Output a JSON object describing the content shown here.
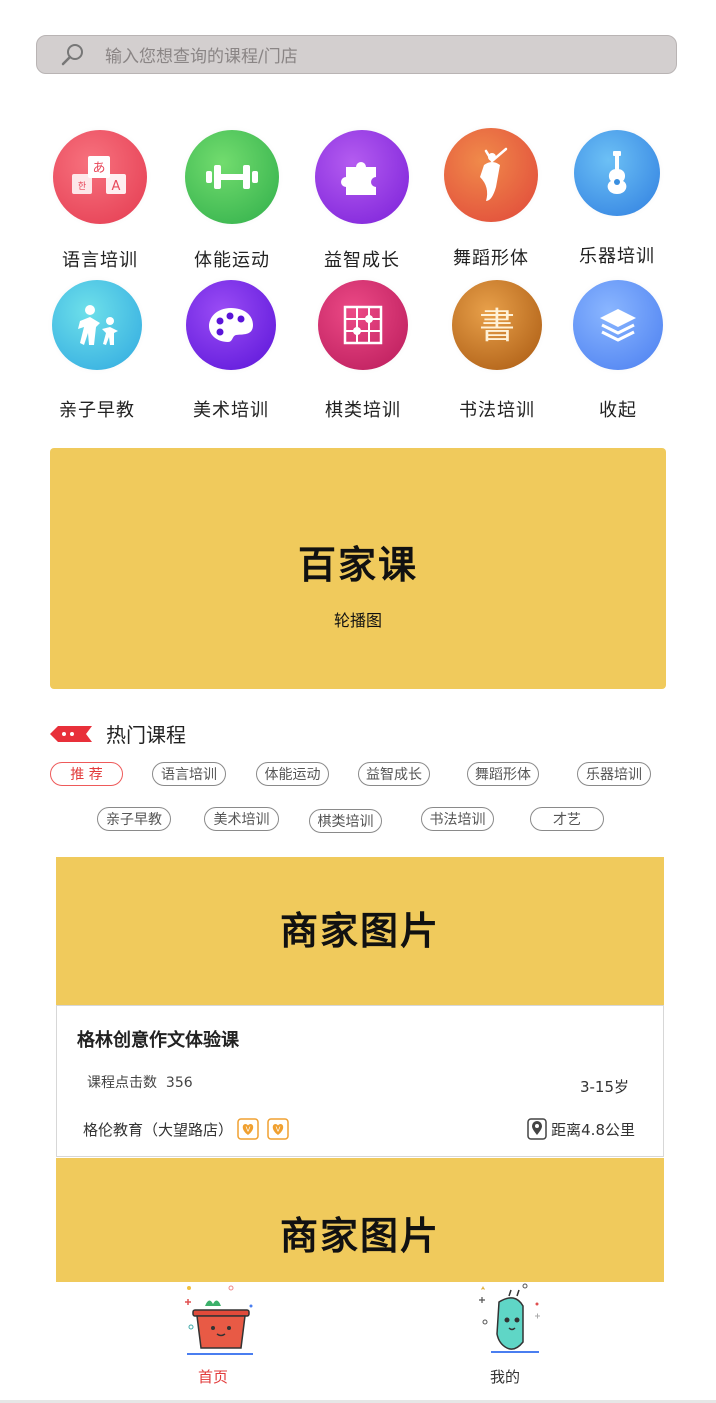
{
  "search": {
    "placeholder": "输入您想查询的课程/门店",
    "icon": "search-icon"
  },
  "categories": [
    {
      "label": "语言培训",
      "icon": "language-icon",
      "color": "#e8485a"
    },
    {
      "label": "体能运动",
      "icon": "dumbbell-icon",
      "color": "#3fbe4e"
    },
    {
      "label": "益智成长",
      "icon": "puzzle-icon",
      "color": "#8a2be2"
    },
    {
      "label": "舞蹈形体",
      "icon": "dancer-icon",
      "color": "#e8503a"
    },
    {
      "label": "乐器培训",
      "icon": "guitar-icon",
      "color": "#3a8fe0"
    },
    {
      "label": "亲子早教",
      "icon": "parent-child-icon",
      "color": "#2fc6d6"
    },
    {
      "label": "美术培训",
      "icon": "palette-icon",
      "color": "#6a1fe0"
    },
    {
      "label": "棋类培训",
      "icon": "chess-board-icon",
      "color": "#d0246a"
    },
    {
      "label": "书法培训",
      "icon": "calligraphy-icon",
      "color": "#c0701a"
    },
    {
      "label": "收起",
      "icon": "layers-icon",
      "color": "#5a8ff0"
    }
  ],
  "banner": {
    "title": "百家课",
    "subtitle": "轮播图",
    "color": "#f0ca5c"
  },
  "hot": {
    "title": "热门课程",
    "tags": [
      "推 荐",
      "语言培训",
      "体能运动",
      "益智成长",
      "舞蹈形体",
      "乐器培训",
      "亲子早教",
      "美术培训",
      "棋类培训",
      "书法培训",
      "才艺"
    ]
  },
  "course": {
    "image_text": "商家图片",
    "title": "格林创意作文体验课",
    "clicks_label": "课程点击数",
    "clicks": "356",
    "age": "3-15岁",
    "store": "格伦教育（大望路店）",
    "distance": "距离4.8公里"
  },
  "next_image_text": "商家图片",
  "tabbar": {
    "home": "首页",
    "mine": "我的",
    "active_color": "#e23b3b"
  }
}
